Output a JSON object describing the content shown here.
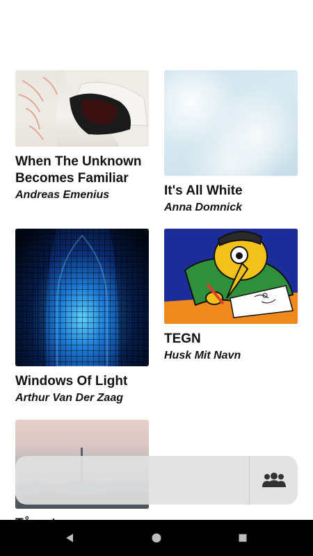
{
  "gallery": {
    "items": [
      {
        "title": "When The Unknown Becomes Familiar",
        "artist": "Andreas Emenius",
        "image": "jacket-artwork"
      },
      {
        "title": "It's All White",
        "artist": "Anna Domnick",
        "image": "white-texture-artwork"
      },
      {
        "title": "Windows Of Light",
        "artist": "Arthur Van Der Zaag",
        "image": "cathedral-window-artwork"
      },
      {
        "title": "TEGN",
        "artist": "Husk Mit Navn",
        "image": "cartoon-drawing-artwork"
      },
      {
        "title": "Tårnet",
        "artist": "",
        "image": "city-skyline-artwork"
      }
    ]
  },
  "bottom_panel": {
    "icon": "people-icon"
  },
  "nav": {
    "back_icon": "back-triangle-icon",
    "home_icon": "home-circle-icon",
    "recents_icon": "recents-square-icon"
  },
  "colors": {
    "background": "#ffffff",
    "text": "#111111",
    "panel": "#e1e1e1",
    "navbar": "#000000"
  }
}
